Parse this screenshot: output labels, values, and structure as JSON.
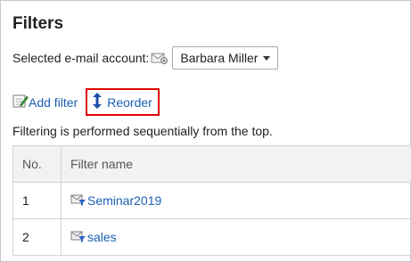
{
  "page": {
    "title": "Filters"
  },
  "account": {
    "label": "Selected e-mail account:",
    "selected": "Barbara Miller"
  },
  "actions": {
    "add_filter": "Add filter",
    "reorder": "Reorder"
  },
  "description": "Filtering is performed sequentially from the top.",
  "table": {
    "headers": [
      "No.",
      "Filter name"
    ],
    "rows": [
      {
        "no": "1",
        "name": "Seminar2019"
      },
      {
        "no": "2",
        "name": "sales"
      }
    ]
  },
  "colors": {
    "link": "#1a5fb4",
    "highlight_border": "#e00000"
  },
  "icons": {
    "account": "mail-icon",
    "add_filter": "add-filter-icon",
    "reorder": "reorder-arrows-icon",
    "filter": "mail-filter-icon"
  }
}
